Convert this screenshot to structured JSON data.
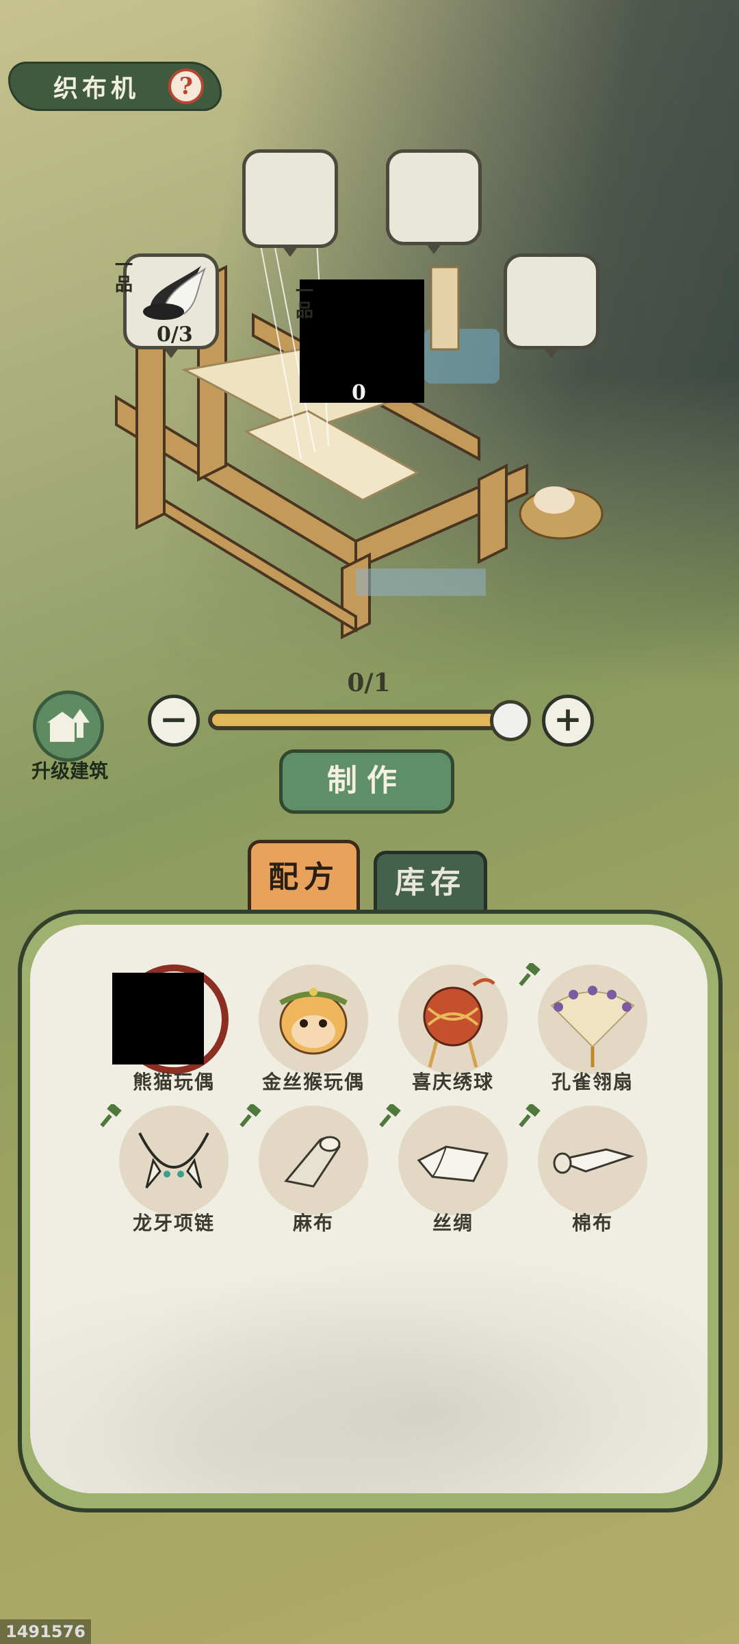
{
  "header": {
    "title": "织布机",
    "help_icon": "question-icon"
  },
  "loom": {
    "slots": [
      {
        "grade": "一品",
        "count": "0/3",
        "icon": "feather-tail-icon"
      },
      {
        "grade": "一品",
        "count": "0",
        "icon": "hidden"
      }
    ]
  },
  "controls": {
    "upgrade_label": "升级建筑",
    "quantity": "0/1",
    "minus_icon": "minus-icon",
    "plus_icon": "plus-icon",
    "make_label": "制作"
  },
  "tabs": {
    "recipe": "配方",
    "stock": "库存",
    "active": "recipe"
  },
  "recipes": [
    {
      "name": "熊猫玩偶",
      "icon": "panda-doll-icon",
      "selected": true,
      "hammer": false
    },
    {
      "name": "金丝猴玩偶",
      "icon": "golden-monkey-doll-icon",
      "hammer": false
    },
    {
      "name": "喜庆绣球",
      "icon": "embroidered-ball-icon",
      "hammer": false
    },
    {
      "name": "孔雀翎扇",
      "icon": "peacock-fan-icon",
      "hammer": true
    },
    {
      "name": "龙牙项链",
      "icon": "dragon-tooth-necklace-icon",
      "hammer": true
    },
    {
      "name": "麻布",
      "icon": "linen-roll-icon",
      "hammer": true
    },
    {
      "name": "丝绸",
      "icon": "silk-icon",
      "hammer": true
    },
    {
      "name": "棉布",
      "icon": "cotton-cloth-icon",
      "hammer": true
    }
  ],
  "watermark": "1491576",
  "colors": {
    "accent_green": "#5e8f66",
    "tab_orange": "#e9a25b",
    "panel_green": "#9fb16f"
  }
}
